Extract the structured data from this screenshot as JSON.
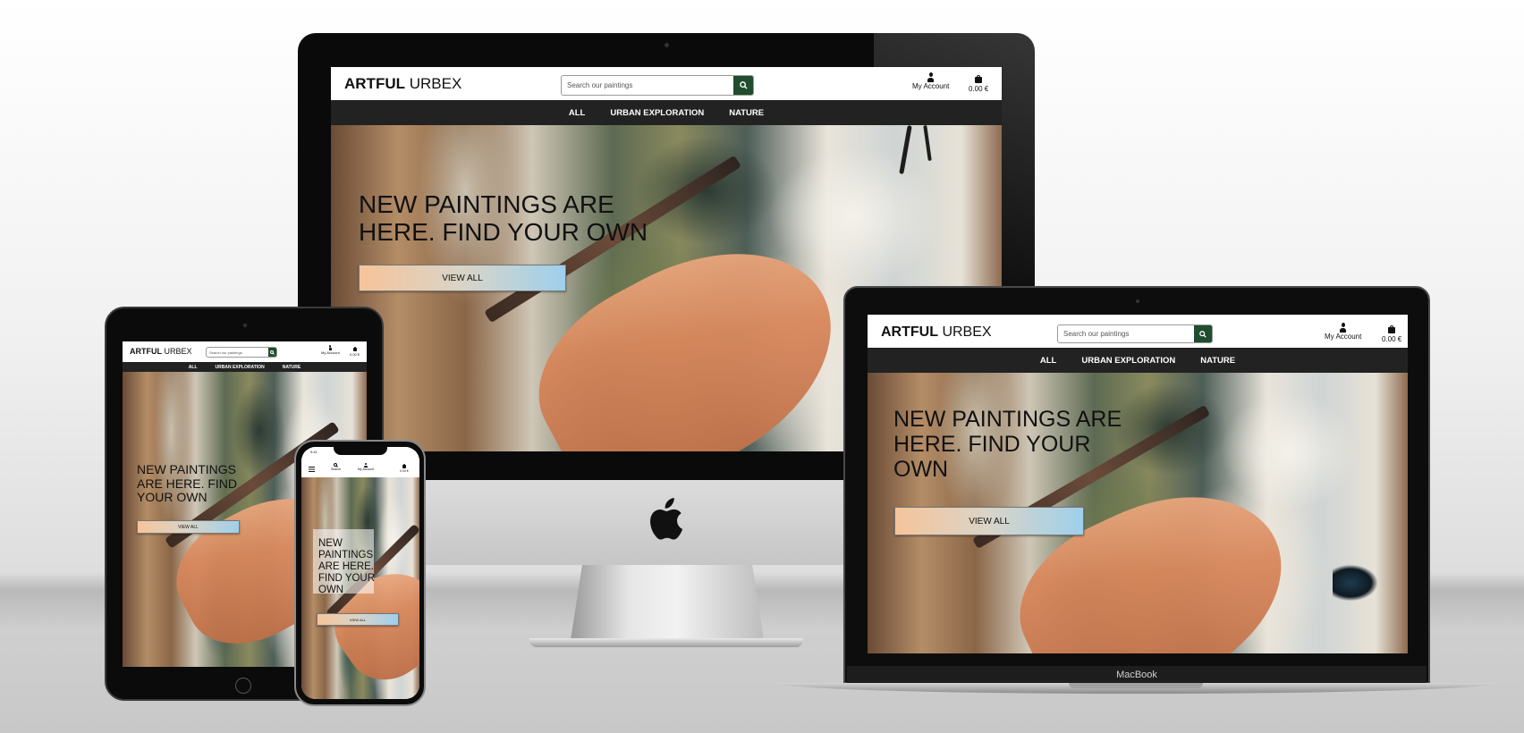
{
  "site": {
    "logo_bold": "ARTFUL",
    "logo_light": "URBEX",
    "search_placeholder": "Search our paintings",
    "account_label": "My Account",
    "bag_total": "0.00 €",
    "nav": [
      "ALL",
      "URBAN EXPLORATION",
      "NATURE"
    ],
    "hero_title": "NEW PAINTINGS ARE HERE. FIND YOUR OWN",
    "hero_button": "VIEW ALL"
  },
  "phone": {
    "time": "9:41",
    "search_label": "Search",
    "account_label": "My Account",
    "bag_total": "0.00 €"
  },
  "devices": {
    "laptop_brand": "MacBook"
  },
  "colors": {
    "search_button": "#1f4d2e",
    "nav_bar": "#222222",
    "button_gradient_start": "#f6c49a",
    "button_gradient_end": "#9ed0ec"
  },
  "icons": {
    "search": "magnifier-icon",
    "account": "user-icon",
    "bag": "shopping-bag-icon",
    "menu": "hamburger-icon",
    "brand": "apple-logo-icon"
  }
}
